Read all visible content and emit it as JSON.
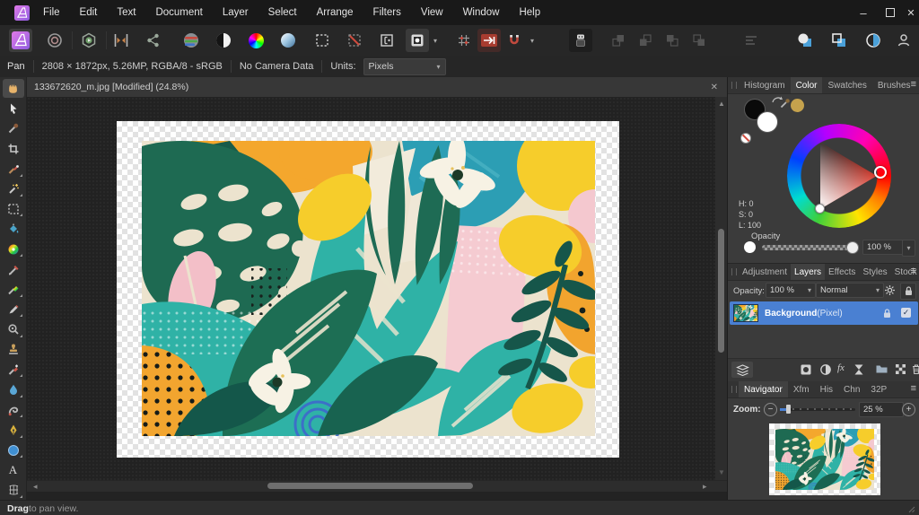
{
  "menubar": {
    "items": [
      "File",
      "Edit",
      "Text",
      "Document",
      "Layer",
      "Select",
      "Arrange",
      "Filters",
      "View",
      "Window",
      "Help"
    ]
  },
  "window_controls": {
    "minimize": "–",
    "close": "✕"
  },
  "toolbar": {
    "icons": [
      "photo-persona",
      "liquify-persona",
      "develop-persona",
      "tone-mapping-persona",
      "export-persona",
      "auto-levels",
      "auto-contrast",
      "auto-colours",
      "auto-white-balance",
      "new-selection",
      "deselect",
      "refine-selection",
      "mask-mode",
      "snapping-grid",
      "pixel-alignment",
      "snapping-magnet",
      "assistant",
      "move-to-front",
      "move-forward",
      "move-backward",
      "move-to-back",
      "alignment",
      "insert-behind",
      "insert-inside",
      "insert-on-top",
      "account"
    ]
  },
  "context_toolbar": {
    "active_tool": "Pan",
    "document_info": "2808 × 1872px, 5.26MP, RGBA/8 - sRGB",
    "camera_info": "No Camera Data",
    "units_label": "Units:",
    "units_value": "Pixels"
  },
  "document_tab": {
    "title": "133672620_m.jpg [Modified] (24.8%)"
  },
  "tools": [
    "view",
    "move",
    "color-picker",
    "crop",
    "selection-brush",
    "flood-select",
    "marquee",
    "flood-fill",
    "gradient",
    "paint-brush",
    "color-replacement",
    "pixel",
    "blemish-removal",
    "clone-stamp",
    "healing-brush",
    "blur",
    "smudge",
    "pen",
    "ellipse",
    "text",
    "mesh-warp"
  ],
  "panels": {
    "color": {
      "tabs": [
        "Histogram",
        "Color",
        "Swatches",
        "Brushes"
      ],
      "active_tab": "Color",
      "h_label": "H: 0",
      "s_label": "S: 0",
      "l_label": "L: 100",
      "opacity_label": "Opacity",
      "opacity_value": "100 %"
    },
    "layers": {
      "tabs": [
        "Adjustment",
        "Layers",
        "Effects",
        "Styles",
        "Stock"
      ],
      "active_tab": "Layers",
      "opacity_label": "Opacity:",
      "opacity_value": "100 %",
      "blend_mode": "Normal",
      "layer": {
        "name": "Background",
        "type": " (Pixel)"
      }
    },
    "navigator": {
      "tabs": [
        "Navigator",
        "Xfm",
        "His",
        "Chn",
        "32P"
      ],
      "active_tab": "Navigator",
      "zoom_label": "Zoom:",
      "zoom_value": "25 %"
    }
  },
  "status_bar": {
    "action": "Drag",
    "hint": " to pan view."
  },
  "glyphs": {
    "dropdown": "▾",
    "menu": "≡",
    "close": "✕",
    "minimize": "–",
    "check": "✓",
    "fx": "fx",
    "text_tool": "A",
    "minus": "−",
    "plus": "+",
    "up": "▲",
    "down": "▼",
    "left": "◂",
    "right": "▸"
  },
  "colors": {
    "selection_blue": "#4a80d2",
    "panel_bg": "#3b3b3b",
    "canvas_bg": "#222222",
    "accent_purple": "#b065dd"
  }
}
